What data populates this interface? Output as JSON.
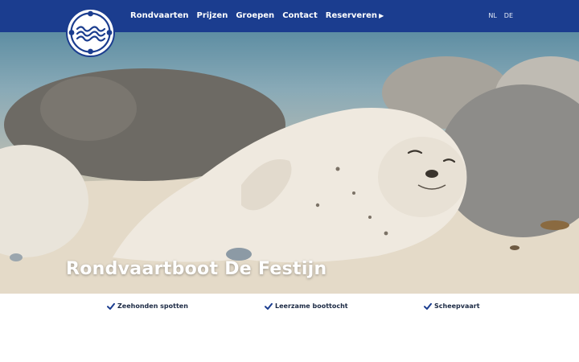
{
  "header": {
    "logo_icon": "wave-circle-logo-icon",
    "brand_color": "#1b3d8f",
    "nav": [
      {
        "label": "Rondvaarten"
      },
      {
        "label": "Prijzen"
      },
      {
        "label": "Groepen"
      },
      {
        "label": "Contact"
      },
      {
        "label": "Reserveren",
        "icon": "triangle-right-icon",
        "icon_glyph": "▶"
      }
    ],
    "languages": [
      {
        "label": "NL"
      },
      {
        "label": "DE"
      }
    ]
  },
  "hero": {
    "image": "resting-seal-on-beach-photo",
    "title": "Rondvaartboot De Festijn"
  },
  "features": [
    {
      "icon": "check-icon",
      "label": "Zeehonden spotten"
    },
    {
      "icon": "check-icon",
      "label": "Leerzame boottocht"
    },
    {
      "icon": "check-icon",
      "label": "Scheepvaart"
    }
  ]
}
